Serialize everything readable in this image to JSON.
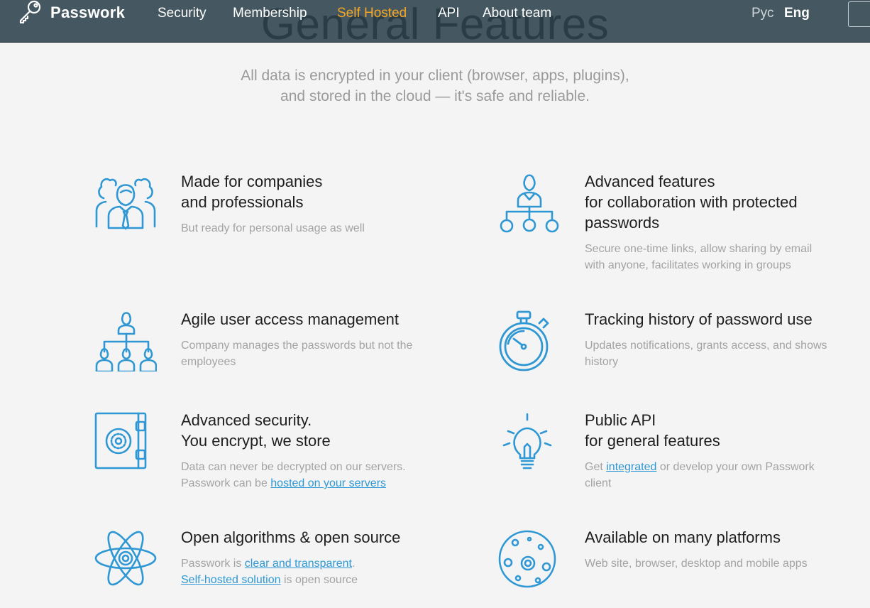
{
  "nav": {
    "brand": "Passwork",
    "links": [
      "Security",
      "Membership",
      "Self Hosted",
      "API",
      "About team"
    ],
    "active_index": 2,
    "lang_ru": "Рус",
    "lang_en": "Eng"
  },
  "colors": {
    "accent": "#2f98d4",
    "active_nav": "#f5a623",
    "topbar": "#283d47"
  },
  "section": {
    "title": "General Features",
    "subtitle_line1": "All data is encrypted in your client (browser, apps, plugins),",
    "subtitle_line2": "and stored in the cloud — it's safe and reliable."
  },
  "features": [
    {
      "icon": "team-icon",
      "title1": "Made for companies",
      "title2": "and professionals",
      "desc1": "But ready for personal usage as well"
    },
    {
      "icon": "collaboration-icon",
      "title1": "Advanced features",
      "title2": "for collaboration with protected",
      "title3": "passwords",
      "desc1": "Secure one-time links, allow sharing by email",
      "desc2": "with anyone, facilitates working in groups"
    },
    {
      "icon": "hierarchy-icon",
      "title1": "Agile user access management",
      "desc1": "Company manages the passwords but not the",
      "desc2": "employees"
    },
    {
      "icon": "stopwatch-icon",
      "title1": "Tracking history of password use",
      "desc1": "Updates notifications, grants access, and shows",
      "desc2": "history"
    },
    {
      "icon": "safe-icon",
      "title1": "Advanced security.",
      "title2": "You encrypt, we store",
      "desc1": "Data can never be decrypted on our servers.",
      "desc2_prefix": "Passwork can be ",
      "desc2_link": "hosted on your servers"
    },
    {
      "icon": "lightbulb-icon",
      "title1": "Public API",
      "title2": "for general features",
      "desc_prefix": "Get ",
      "desc_link": "integrated",
      "desc_suffix1": " or develop your own Passwork",
      "desc2": "client"
    },
    {
      "icon": "atom-icon",
      "title1": "Open algorithms & open source",
      "desc1_prefix": "Passwork is ",
      "desc1_link": "clear and transparent",
      "desc1_suffix": ".",
      "desc2_link": "Self-hosted solution",
      "desc2_suffix": " is open source"
    },
    {
      "icon": "planet-icon",
      "title1": "Available on many platforms",
      "desc1": "Web site, browser, desktop and mobile apps"
    }
  ]
}
